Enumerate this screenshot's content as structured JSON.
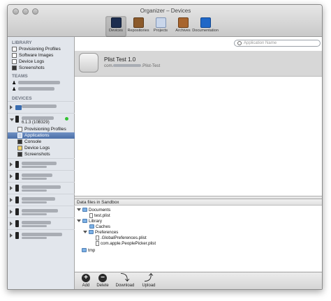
{
  "window": {
    "title": "Organizer – Devices"
  },
  "toolbar": {
    "tools": [
      {
        "label": "Devices",
        "icon": "devices-icon",
        "active": true
      },
      {
        "label": "Repositories",
        "icon": "repositories-icon",
        "active": false
      },
      {
        "label": "Projects",
        "icon": "projects-icon",
        "active": false
      },
      {
        "label": "Archives",
        "icon": "archives-icon",
        "active": false
      },
      {
        "label": "Documentation",
        "icon": "documentation-icon",
        "active": false
      }
    ]
  },
  "sidebar": {
    "library_header": "LIBRARY",
    "library_items": [
      "Provisioning Profiles",
      "Software Images",
      "Device Logs",
      "Screenshots"
    ],
    "teams_header": "TEAMS",
    "devices_header": "DEVICES",
    "device_version": "6.1.3 (10B329)",
    "device_subitems": [
      "Provisioning Profiles",
      "Applications",
      "Console",
      "Device Logs",
      "Screenshots"
    ],
    "selected_subitem": "Applications"
  },
  "search": {
    "placeholder": "Application Name"
  },
  "app": {
    "name": "Plist Test 1.0",
    "bundle_prefix": "com.",
    "bundle_suffix": ".Plist-Test"
  },
  "files": {
    "header": "Data files in Sandbox",
    "tree": [
      {
        "name": "Documents",
        "type": "folder",
        "depth": 0,
        "open": true
      },
      {
        "name": "test.plist",
        "type": "file",
        "depth": 1
      },
      {
        "name": "Library",
        "type": "folder",
        "depth": 0,
        "open": true
      },
      {
        "name": "Caches",
        "type": "folder",
        "depth": 1
      },
      {
        "name": "Preferences",
        "type": "folder",
        "depth": 1,
        "open": true
      },
      {
        "name": ".GlobalPreferences.plist",
        "type": "file",
        "depth": 2
      },
      {
        "name": "com.apple.PeoplePicker.plist",
        "type": "file",
        "depth": 2
      },
      {
        "name": "tmp",
        "type": "folder",
        "depth": 0
      }
    ]
  },
  "actions": {
    "add": "Add",
    "delete": "Delete",
    "download": "Download",
    "upload": "Upload"
  },
  "colors": {
    "selection": "#5a7db5",
    "status_green": "#34c234"
  }
}
